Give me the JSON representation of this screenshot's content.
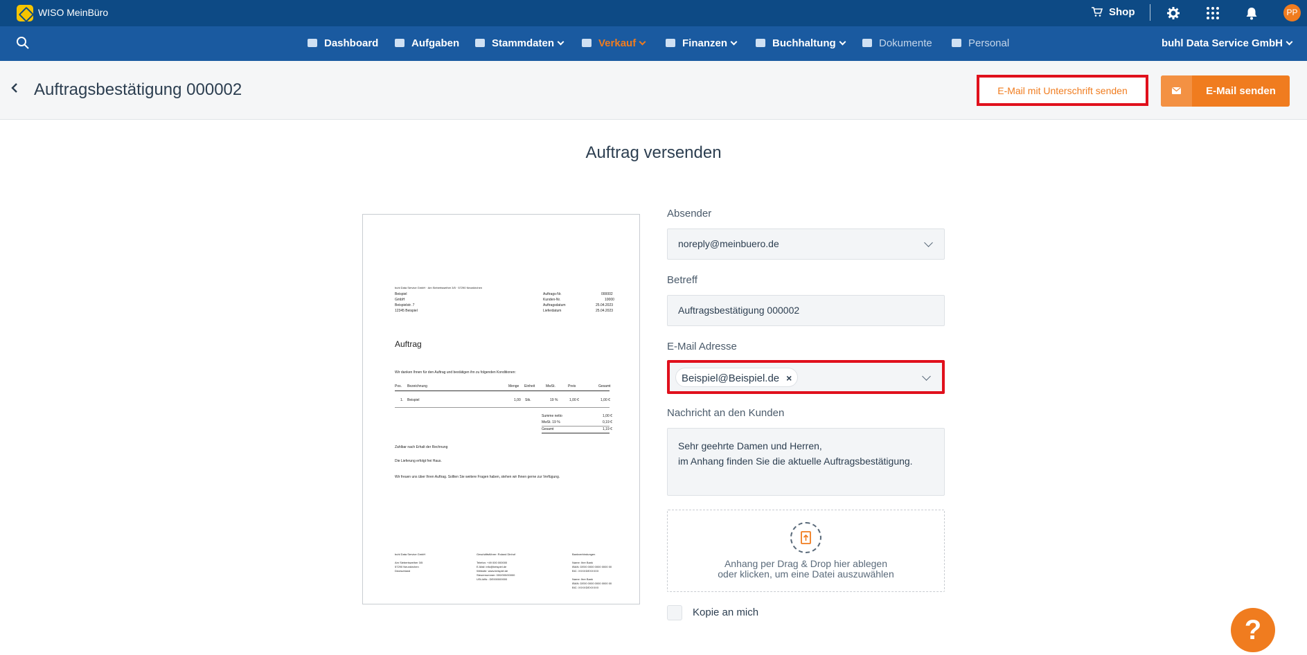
{
  "app": {
    "name": "WISO MeinBüro"
  },
  "topbar": {
    "shop_label": "Shop",
    "avatar_initials": "PP"
  },
  "nav": {
    "items": [
      {
        "label": "Dashboard"
      },
      {
        "label": "Aufgaben"
      },
      {
        "label": "Stammdaten"
      },
      {
        "label": "Verkauf"
      },
      {
        "label": "Finanzen"
      },
      {
        "label": "Buchhaltung"
      },
      {
        "label": "Dokumente"
      },
      {
        "label": "Personal"
      }
    ],
    "company": "buhl Data Service GmbH"
  },
  "header": {
    "title": "Auftragsbestätigung 000002",
    "sig_button": "E-Mail mit Unterschrift senden",
    "send_button": "E-Mail senden"
  },
  "main": {
    "section_title": "Auftrag versenden"
  },
  "form": {
    "sender_label": "Absender",
    "sender_value": "noreply@meinbuero.de",
    "subject_label": "Betreff",
    "subject_value": "Auftragsbestätigung 000002",
    "email_label": "E-Mail Adresse",
    "email_chip": "Beispiel@Beispiel.de",
    "message_label": "Nachricht an den Kunden",
    "message_line1": "Sehr geehrte Damen und Herren,",
    "message_line2": "im Anhang finden Sie die aktuelle Auftragsbestätigung.",
    "attach_line1": "Anhang per Drag & Drop hier ablegen",
    "attach_line2": "oder klicken, um eine Datei auszuwählen",
    "copy_label": "Kopie an mich"
  },
  "preview": {
    "sender_line": "buhl Data Service GmbH · Am Siebertsweiher 3/5 · 57290 Neunkirchen",
    "recipient": [
      "Beispiel",
      "GmbH",
      "Beispielstr. 7",
      "12345 Beispiel"
    ],
    "meta_labels": [
      "Auftrags-Nr.",
      "Kunden-Nr.",
      "Auftragsdatum",
      "Lieferdatum"
    ],
    "meta_values": [
      "000002",
      "10000",
      "25.04.2023",
      "25.04.2023"
    ],
    "heading": "Auftrag",
    "intro": "Wir danken Ihnen für den Auftrag und bestätigen ihn zu folgenden Konditionen:",
    "table_headers": [
      "Pos.",
      "Bezeichnung",
      "Menge",
      "Einheit",
      "MwSt.",
      "Preis",
      "Gesamt"
    ],
    "table_row": [
      "1.",
      "Beispiel",
      "1,00",
      "Stk.",
      "19 %",
      "1,00 €",
      "1,00 €"
    ],
    "sum_labels": [
      "Summe netto",
      "MwSt. 19 %",
      "Gesamt"
    ],
    "sum_values": [
      "1,00 €",
      "0,19 €",
      "1,19 €"
    ],
    "line1": "Zahlbar nach Erhalt der Rechnung",
    "line2": "Die Lieferung erfolgt frei Haus.",
    "line3": "Wir freuen uns über Ihren Auftrag. Sollten Sie weitere Fragen haben, stehen wir Ihnen gerne zur Verfügung.",
    "footer_col1": [
      "buhl Data Service GmbH",
      "",
      "Am Siebertsweiher 3/5",
      "57290 Neunkirchen",
      "Deutschland"
    ],
    "footer_col2": [
      "Geschäftsführer: Roland Dinhof",
      "",
      "Telefon: +49 000 000000",
      "E-Mail: info@beispiel.de",
      "Website: www.beispiel.de",
      "Steuernummer: 000/000/00000",
      "USt-IdNr.: DE000000000"
    ],
    "footer_col3": [
      "Bankverbindungen",
      "",
      "Name: Ihre Bank",
      "IBAN: DE00 0000 0000 0000 00",
      "BIC: XXXXDEXXXXX",
      "",
      "Name: Ihre Bank",
      "IBAN: DE00 0000 0000 0000 00",
      "BIC: XXXXDEXXXXX"
    ]
  },
  "colors": {
    "topbar": "#0d4a85",
    "navbar": "#1a5aa0",
    "accent": "#f07c1f",
    "highlight": "#e0101c"
  },
  "icons": [
    "shopping-cart-icon",
    "settings-gear-icon",
    "apps-grid-icon",
    "bell-icon",
    "search-icon",
    "back-chevron-icon",
    "mail-icon",
    "upload-file-icon",
    "help-question-icon"
  ]
}
